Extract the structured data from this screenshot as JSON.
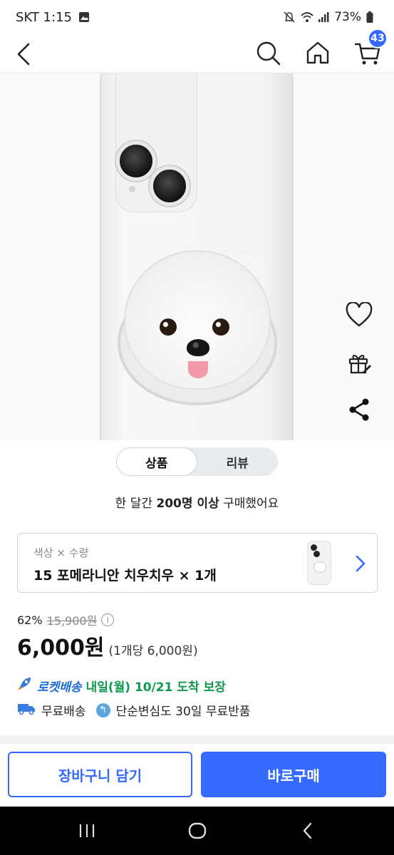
{
  "status_bar": {
    "carrier_time": "SKT 1:15",
    "battery": "73%",
    "icons": [
      "gallery-icon",
      "mute-icon",
      "wifi-icon",
      "signal-icon",
      "battery-icon"
    ]
  },
  "header": {
    "cart_count": "43",
    "icons": [
      "back-icon",
      "search-icon",
      "home-icon",
      "cart-icon"
    ],
    "accent_color": "#346aff"
  },
  "carousel": {
    "image": "white phone case with pomeranian dog grip",
    "page_count": 3,
    "active_index": 0
  },
  "side_actions": [
    "heart-icon",
    "gift-icon",
    "share-icon"
  ],
  "tabs": [
    {
      "label": "상품",
      "active": true
    },
    {
      "label": "리뷰",
      "active": false
    }
  ],
  "purchase_note": {
    "prefix": "한 달간 ",
    "highlight": "200명 이상",
    "suffix": " 구매했어요"
  },
  "option": {
    "label": "색상 × 수량",
    "value": "15 포메라니안 치우치우 × 1개"
  },
  "price": {
    "discount_rate": "62%",
    "original_price": "15,900원",
    "sale_price": "6,000원",
    "unit_price": "(1개당 6,000원)"
  },
  "delivery": {
    "rocket_label": "로켓배송",
    "arrival": "내일(월) 10/21 도착 보장",
    "free_shipping": "무료배송",
    "free_return": "단순변심도 30일 무료반품",
    "rocket_color": "#0d9a4d"
  },
  "actions": {
    "add_to_cart": "장바구니 담기",
    "buy_now": "바로구매"
  }
}
